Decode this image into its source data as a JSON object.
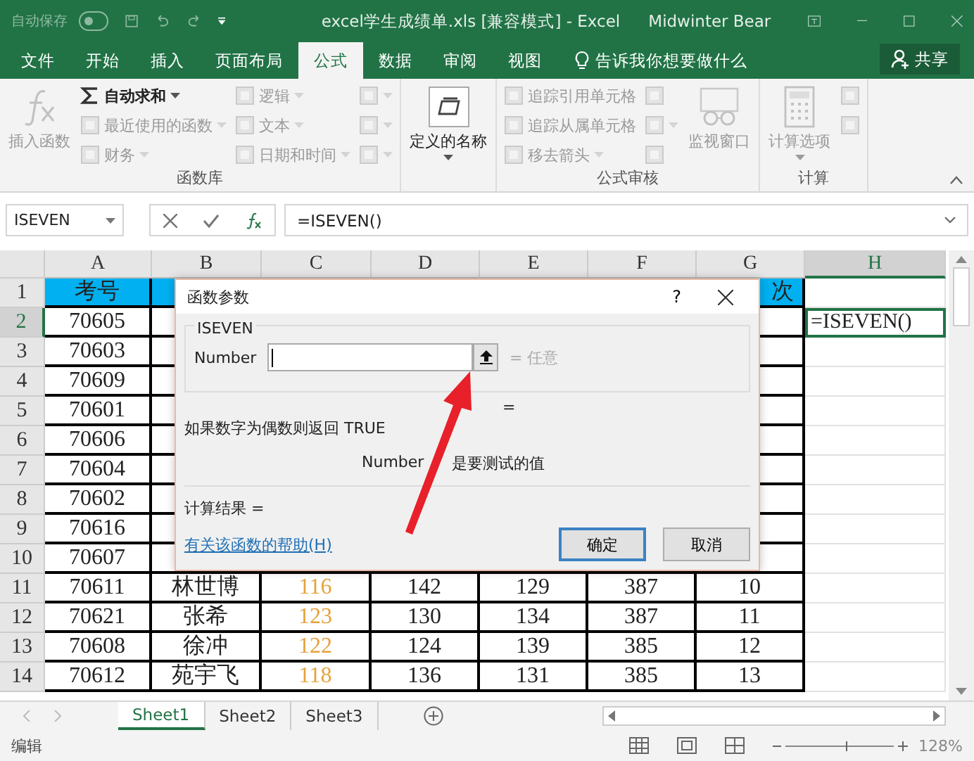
{
  "title_bar": {
    "autosave": {
      "label": "自动保存",
      "on": false
    },
    "title": "excel学生成绩单.xls  [兼容模式]  -  Excel",
    "user": "Midwinter Bear"
  },
  "tabs": [
    {
      "label": "文件",
      "selected": false
    },
    {
      "label": "开始",
      "selected": false
    },
    {
      "label": "插入",
      "selected": false
    },
    {
      "label": "页面布局",
      "selected": false
    },
    {
      "label": "公式",
      "selected": true
    },
    {
      "label": "数据",
      "selected": false
    },
    {
      "label": "审阅",
      "selected": false
    },
    {
      "label": "视图",
      "selected": false
    }
  ],
  "tell_me": "告诉我你想要做什么",
  "share": "共享",
  "ribbon": {
    "groups": [
      {
        "label": "函数库",
        "columns": [
          [
            {
              "kind": "large",
              "label": "插入函数",
              "disabled": true,
              "dropdown": false
            }
          ],
          [
            {
              "kind": "small",
              "label": "自动求和",
              "disabled": false,
              "dropdown": true
            },
            {
              "kind": "small",
              "label": "最近使用的函数",
              "disabled": true,
              "dropdown": true
            },
            {
              "kind": "small",
              "label": "财务",
              "disabled": true,
              "dropdown": true
            }
          ],
          [
            {
              "kind": "small",
              "label": "逻辑",
              "disabled": true,
              "dropdown": true
            },
            {
              "kind": "small",
              "label": "文本",
              "disabled": true,
              "dropdown": true
            },
            {
              "kind": "small",
              "label": "日期和时间",
              "disabled": true,
              "dropdown": true
            }
          ],
          [
            {
              "kind": "icon",
              "disabled": true,
              "dropdown": true
            },
            {
              "kind": "icon",
              "disabled": true,
              "dropdown": true
            },
            {
              "kind": "icon",
              "disabled": true,
              "dropdown": true
            }
          ]
        ]
      },
      {
        "columns": [
          [
            {
              "kind": "large",
              "label": "定义的名称",
              "disabled": false,
              "dropdown": true
            }
          ]
        ]
      },
      {
        "label": "公式审核",
        "columns": [
          [
            {
              "kind": "small",
              "label": "追踪引用单元格",
              "disabled": true,
              "dropdown": false
            },
            {
              "kind": "small",
              "label": "追踪从属单元格",
              "disabled": true,
              "dropdown": false
            },
            {
              "kind": "small",
              "label": "移去箭头",
              "disabled": true,
              "dropdown": true
            }
          ],
          [
            {
              "kind": "icon",
              "disabled": true,
              "dropdown": false
            },
            {
              "kind": "icon",
              "disabled": true,
              "dropdown": true
            },
            {
              "kind": "icon",
              "disabled": true,
              "dropdown": false
            }
          ],
          [
            {
              "kind": "large",
              "label": "监视窗口",
              "disabled": true,
              "dropdown": false
            }
          ]
        ]
      },
      {
        "label": "计算",
        "columns": [
          [
            {
              "kind": "large",
              "label": "计算选项",
              "disabled": true,
              "dropdown": true
            }
          ],
          [
            {
              "kind": "icon",
              "disabled": true,
              "dropdown": false
            },
            {
              "kind": "icon",
              "disabled": true,
              "dropdown": false
            }
          ]
        ]
      }
    ]
  },
  "formula_bar": {
    "name_box": "ISEVEN",
    "formula": "=ISEVEN()"
  },
  "columns": [
    {
      "label": "A",
      "selected": false
    },
    {
      "label": "B",
      "selected": false
    },
    {
      "label": "C",
      "selected": false
    },
    {
      "label": "D",
      "selected": false
    },
    {
      "label": "E",
      "selected": false
    },
    {
      "label": "F",
      "selected": false
    },
    {
      "label": "G",
      "selected": false
    },
    {
      "label": "H",
      "selected": true
    }
  ],
  "rows": [
    {
      "num": "1",
      "kind": "header",
      "selected": false,
      "cells": [
        "考号",
        null,
        null,
        null,
        null,
        null,
        "次",
        null
      ]
    },
    {
      "num": "2",
      "kind": "data",
      "selected": true,
      "cells": [
        "70605",
        null,
        null,
        null,
        null,
        null,
        null,
        "=ISEVEN()"
      ]
    },
    {
      "num": "3",
      "kind": "data",
      "selected": false,
      "cells": [
        "70603",
        null,
        null,
        null,
        null,
        null,
        null,
        null
      ]
    },
    {
      "num": "4",
      "kind": "data",
      "selected": false,
      "cells": [
        "70609",
        null,
        null,
        null,
        null,
        null,
        null,
        null
      ]
    },
    {
      "num": "5",
      "kind": "data",
      "selected": false,
      "cells": [
        "70601",
        null,
        null,
        null,
        null,
        null,
        null,
        null
      ]
    },
    {
      "num": "6",
      "kind": "data",
      "selected": false,
      "cells": [
        "70606",
        null,
        null,
        null,
        null,
        null,
        null,
        null
      ]
    },
    {
      "num": "7",
      "kind": "data",
      "selected": false,
      "cells": [
        "70604",
        null,
        null,
        null,
        null,
        null,
        null,
        null
      ]
    },
    {
      "num": "8",
      "kind": "data",
      "selected": false,
      "cells": [
        "70602",
        null,
        null,
        null,
        null,
        null,
        null,
        null
      ]
    },
    {
      "num": "9",
      "kind": "data",
      "selected": false,
      "cells": [
        "70616",
        null,
        null,
        null,
        null,
        null,
        null,
        null
      ]
    },
    {
      "num": "10",
      "kind": "data",
      "selected": false,
      "cells": [
        "70607",
        null,
        null,
        null,
        null,
        null,
        null,
        null
      ]
    },
    {
      "num": "11",
      "kind": "data",
      "selected": false,
      "cells": [
        "70611",
        "林世博",
        "116",
        "142",
        "129",
        "387",
        "10",
        null
      ]
    },
    {
      "num": "12",
      "kind": "data",
      "selected": false,
      "cells": [
        "70621",
        "张希",
        "123",
        "130",
        "134",
        "387",
        "11",
        null
      ]
    },
    {
      "num": "13",
      "kind": "data",
      "selected": false,
      "cells": [
        "70608",
        "徐冲",
        "122",
        "124",
        "139",
        "385",
        "12",
        null
      ]
    },
    {
      "num": "14",
      "kind": "data",
      "selected": false,
      "cells": [
        "70612",
        "苑宇飞",
        "118",
        "136",
        "131",
        "385",
        "13",
        null
      ]
    }
  ],
  "dialog": {
    "title": "函数参数",
    "help": "?",
    "function_name": "ISEVEN",
    "argument": {
      "label": "Number",
      "result": "= 任意"
    },
    "result_line": "=",
    "description": "如果数字为偶数则返回 TRUE",
    "argument_help": {
      "label": "Number",
      "text": "是要测试的值"
    },
    "calc_result": "计算结果 =",
    "help_link": "有关该函数的帮助(H)",
    "buttons": [
      {
        "label": "确定",
        "default": true
      },
      {
        "label": "取消",
        "default": false
      }
    ]
  },
  "sheets": [
    {
      "label": "Sheet1",
      "selected": true
    },
    {
      "label": "Sheet2",
      "selected": false
    },
    {
      "label": "Sheet3",
      "selected": false
    }
  ],
  "status_bar": {
    "mode": "编辑",
    "zoom_slider": {
      "level": 0.56
    },
    "zoom": "128%"
  }
}
